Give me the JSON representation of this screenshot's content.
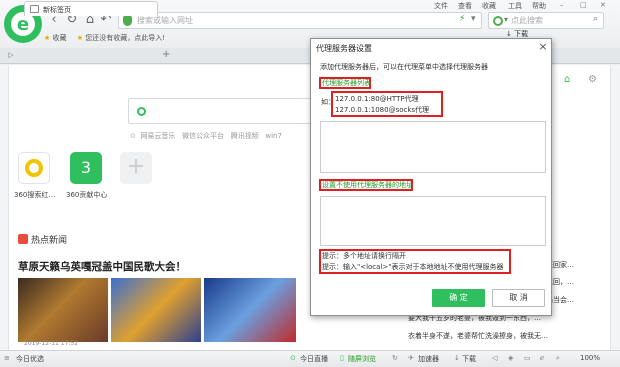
{
  "menu": {
    "file": "文件",
    "view": "查看",
    "favorites": "收藏",
    "tools": "工具",
    "help": "帮助"
  },
  "address": {
    "placeholder": "搜索或输入网址"
  },
  "search": {
    "placeholder": "点此搜索"
  },
  "bookmarks": {
    "fav": "收藏",
    "hint": "您还没有收藏，点此导入!"
  },
  "download_label": "下载",
  "tab": {
    "label": "新标签页"
  },
  "newpage": {
    "links": [
      "网易云音乐",
      "微信公众平台",
      "腾讯视频",
      "win7"
    ],
    "tiles": [
      {
        "label": "360搜索红…"
      },
      {
        "label": "360贡献中心",
        "digit": "3"
      }
    ],
    "hot_title": "热点新闻",
    "headline": "草原天籁乌英嘎冠盖中国民歌大会！",
    "timestamp": "2019-12-11 17:52",
    "news": [
      "天下班回家…",
      "怒后返回，…",
      "连邮船当会…",
      "要大我十五岁的老婆，被我毁到一东西，…",
      "衣着半身不遂，老婆帮忙洗澡擦身，被我无…"
    ]
  },
  "status": {
    "left": "今日优选",
    "live": "今日直播",
    "browse": "随屏浏览",
    "accel": "加速器",
    "download": "下载",
    "zoom": "100%"
  },
  "dialog": {
    "title": "代理服务器设置",
    "close": "×",
    "desc": "添加代理服务器后，可以在代理菜单中选择代理服务器",
    "list_label": "代理服务器列表",
    "example_prefix": "如：",
    "example1": "127.0.0.1:80@HTTP代理",
    "example2": "127.0.0.1:1080@socks代理",
    "bypass_label": "设置不使用代理服务器的地址",
    "tip1": "提示：多个地址请换行隔开",
    "tip2": "提示：输入\"<local>\"表示对于本地地址不使用代理服务器",
    "ok": "确 定",
    "cancel": "取 消"
  },
  "colors": {
    "accent": "#2fbf5f",
    "highlight": "#e02020",
    "label_green": "#2a9a2a"
  }
}
